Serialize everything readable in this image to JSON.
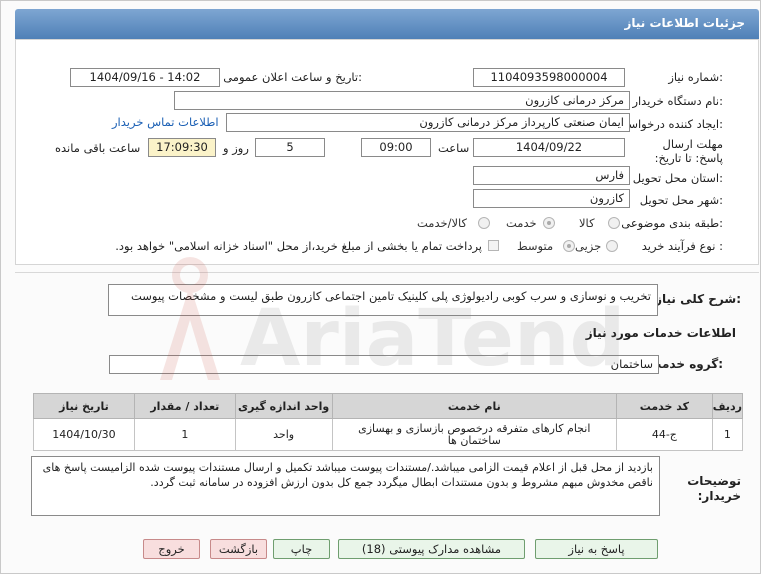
{
  "header": {
    "title": "جزئیات اطلاعات نیاز"
  },
  "form": {
    "need_number_label": "شماره نیاز:",
    "need_number": "1104093598000004",
    "announce_label": "تاریخ و ساعت اعلان عمومی:",
    "announce_value": "1404/09/16 - 14:02",
    "buyer_org_label": "نام دستگاه خریدار:",
    "buyer_org": "مرکز درمانی کازرون",
    "creator_label": "ایجاد کننده درخواست:",
    "creator": "ایمان صنعتی کارپرداز مرکز درمانی کازرون",
    "contact_link": "اطلاعات تماس خریدار",
    "deadline_label": "مهلت ارسال پاسخ: تا تاریخ:",
    "deadline_date": "1404/09/22",
    "time_label": "ساعت",
    "deadline_time": "09:00",
    "days": "5",
    "days_label": "روز و",
    "remaining": "17:09:30",
    "remaining_label": "ساعت باقی مانده",
    "province_label": "استان محل تحویل:",
    "province": "فارس",
    "city_label": "شهر محل تحویل:",
    "city": "کازرون",
    "category_label": "طبقه بندی موضوعی:",
    "category_options": [
      "کالا",
      "خدمت",
      "کالا/خدمت"
    ],
    "category_selected": "خدمت",
    "process_label": "نوع فرآیند خرید :",
    "process_options": [
      "جزیی",
      "متوسط"
    ],
    "process_selected": "متوسط",
    "payment_note": "پرداخت تمام یا بخشی از مبلغ خرید،از محل \"اسناد خزانه اسلامی\" خواهد بود."
  },
  "summary": {
    "label": "شرح کلی نیاز:",
    "text": "تخریب و نوسازی و سرب کوبی رادیولوژی پلی کلینیک تامین اجتماعی کازرون طبق لیست و مشخصات پیوست"
  },
  "services": {
    "section_title": "اطلاعات خدمات مورد نیاز",
    "group_label": "گروه خدمت:",
    "group_value": "ساختمان",
    "columns": [
      "ردیف",
      "کد خدمت",
      "نام خدمت",
      "واحد اندازه گیری",
      "تعداد / مقدار",
      "تاریخ نیاز"
    ],
    "rows": [
      [
        "1",
        "ج-44",
        "انجام کارهای متفرقه درخصوص بازسازی و بهسازی ساختمان ها",
        "واحد",
        "1",
        "1404/10/30"
      ]
    ]
  },
  "notes": {
    "label": "توضیحات خریدار:",
    "text": "بازدید از محل قبل از اعلام قیمت الزامی میباشد./مستندات پیوست میباشد تکمیل و ارسال مستندات پیوست شده الزامیست پاسخ های ناقص مخدوش مبهم مشروط و بدون مستندات ابطال میگردد جمع کل بدون ارزش افزوده در سامانه ثبت گردد."
  },
  "buttons": {
    "reply": "پاسخ به نیاز",
    "docs": "مشاهده مدارک پیوستی (18)",
    "print": "چاپ",
    "back": "بازگشت",
    "exit": "خروج"
  },
  "watermark": "AriaTender.net",
  "colors": {
    "header": "#5a88bf",
    "link": "#1a5fb4",
    "highlight": "#fbf3c9"
  }
}
